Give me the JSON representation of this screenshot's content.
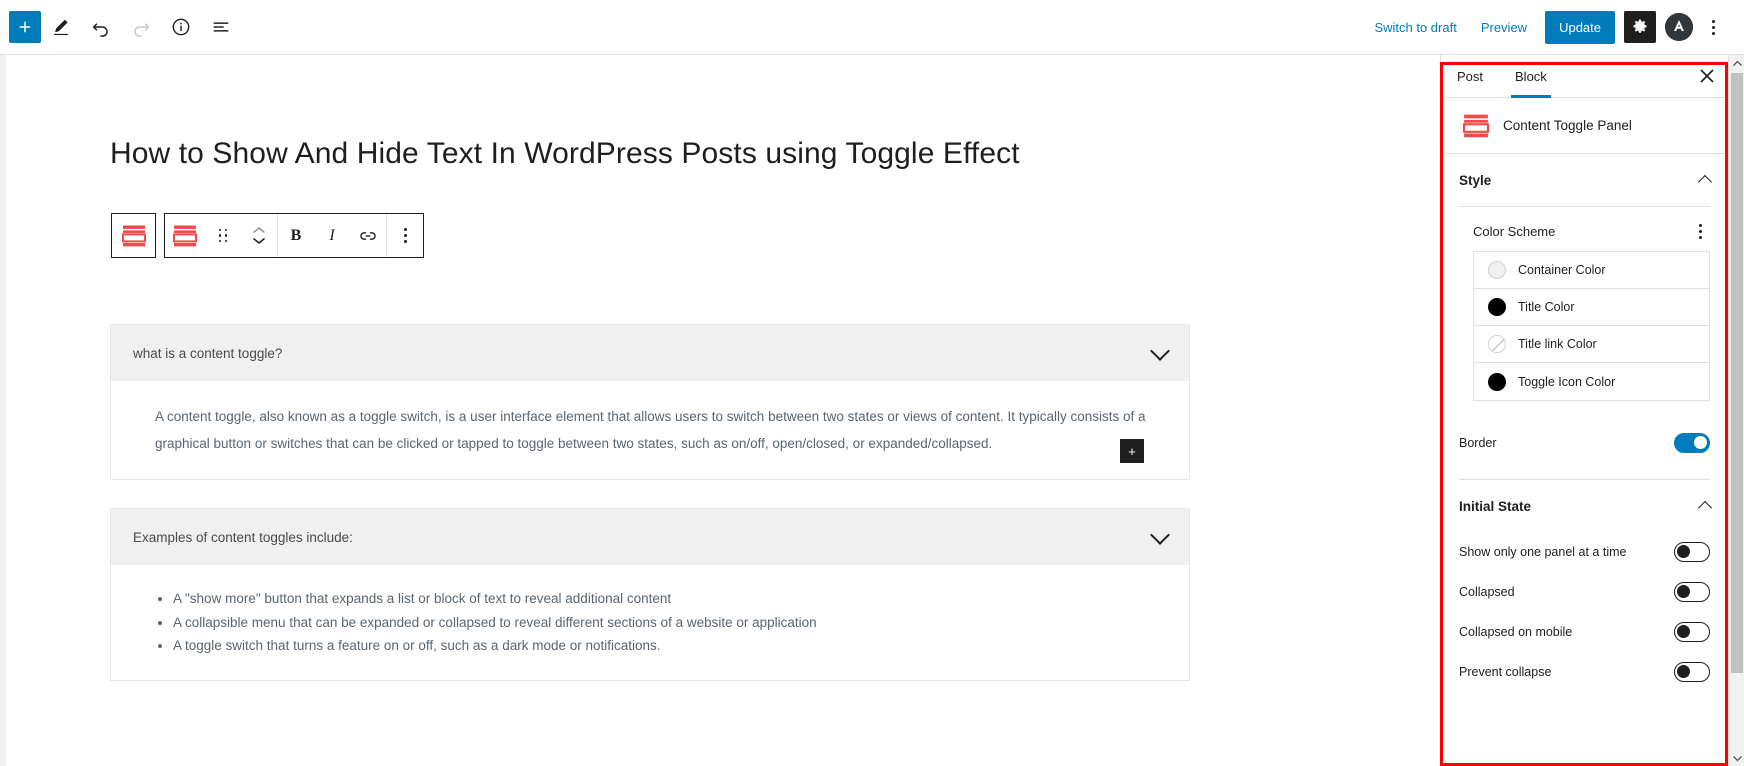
{
  "topbar": {
    "add_block_label": "+",
    "tools_icon": "pencil-icon",
    "undo_icon": "undo-icon",
    "redo_icon": "redo-icon",
    "info_icon": "info-icon",
    "list_view_icon": "list-view-icon",
    "switch_to_draft": "Switch to draft",
    "preview": "Preview",
    "update": "Update",
    "settings_icon": "gear-icon",
    "avatar_icon": "avatar-icon",
    "options_icon": "kebab-menu-icon",
    "accent_color": "#007cba"
  },
  "editor": {
    "post_title": "How to Show And Hide Text In WordPress Posts using Toggle Effect",
    "toolbar": {
      "parent_block_icon": "content-toggle-block-icon",
      "block_icon": "content-toggle-block-icon",
      "drag_icon": "drag-handle-icon",
      "move_up_icon": "chevron-up-icon",
      "move_down_icon": "chevron-down-icon",
      "bold_label": "B",
      "italic_label": "I",
      "link_icon": "link-icon",
      "more_icon": "kebab-menu-icon"
    },
    "panels": [
      {
        "title": "what is a content toggle?",
        "chevron_icon": "chevron-down-icon",
        "type": "paragraph",
        "body": "A content toggle, also known as a toggle switch, is a user interface element that allows users to switch between two states or views of content. It typically consists of a graphical button or switches that can be clicked or tapped to toggle between two states, such as on/off, open/closed, or expanded/collapsed.",
        "add_block_label": "+"
      },
      {
        "title": "Examples of content toggles include:",
        "chevron_icon": "chevron-down-icon",
        "type": "list",
        "items": [
          "A \"show more\" button that expands a list or block of text to reveal additional content",
          "A collapsible menu that can be expanded or collapsed to reveal different sections of a website or application",
          "A toggle switch that turns a feature on or off, such as a dark mode or notifications."
        ]
      }
    ]
  },
  "sidebar": {
    "highlight_color": "#ff0000",
    "tabs": [
      {
        "label": "Post",
        "active": false
      },
      {
        "label": "Block",
        "active": true
      }
    ],
    "close_icon": "close-icon",
    "block": {
      "icon": "content-toggle-block-icon",
      "name": "Content Toggle Panel"
    },
    "style_section": {
      "title": "Style",
      "collapse_icon": "chevron-up-icon",
      "color_scheme": {
        "title": "Color Scheme",
        "options_icon": "kebab-menu-icon",
        "swatches": [
          {
            "label": "Container Color",
            "color": "#f0f0f0",
            "none": false
          },
          {
            "label": "Title Color",
            "color": "#000000",
            "none": false
          },
          {
            "label": "Title link Color",
            "color": "#ffffff",
            "none": true
          },
          {
            "label": "Toggle Icon Color",
            "color": "#000000",
            "none": false
          }
        ]
      },
      "border": {
        "label": "Border",
        "value": true
      }
    },
    "initial_state_section": {
      "title": "Initial State",
      "collapse_icon": "chevron-up-icon",
      "options": [
        {
          "label": "Show only one panel at a time",
          "value": false
        },
        {
          "label": "Collapsed",
          "value": false
        },
        {
          "label": "Collapsed on mobile",
          "value": false
        },
        {
          "label": "Prevent collapse",
          "value": false
        }
      ]
    }
  }
}
